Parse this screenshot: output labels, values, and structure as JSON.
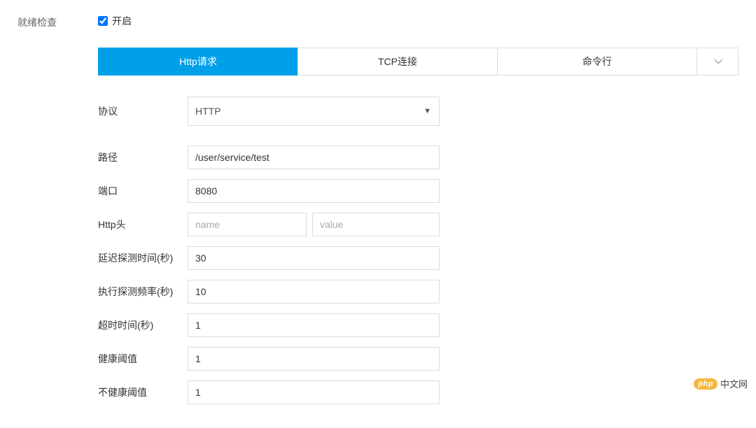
{
  "section": {
    "title": "就绪检查",
    "enable_label": "开启",
    "enabled": true
  },
  "tabs": {
    "http": "Http请求",
    "tcp": "TCP连接",
    "cmd": "命令行"
  },
  "form": {
    "protocol_label": "协议",
    "protocol_value": "HTTP",
    "path_label": "路径",
    "path_value": "/user/service/test",
    "port_label": "端口",
    "port_value": "8080",
    "http_header_label": "Http头",
    "header_name_placeholder": "name",
    "header_value_placeholder": "value",
    "delay_label": "延迟探测时间(秒)",
    "delay_value": "30",
    "period_label": "执行探测频率(秒)",
    "period_value": "10",
    "timeout_label": "超时时间(秒)",
    "timeout_value": "1",
    "healthy_label": "健康阈值",
    "healthy_value": "1",
    "unhealthy_label": "不健康阈值",
    "unhealthy_value": "1"
  },
  "watermark": {
    "badge": "php",
    "text": "中文网"
  }
}
